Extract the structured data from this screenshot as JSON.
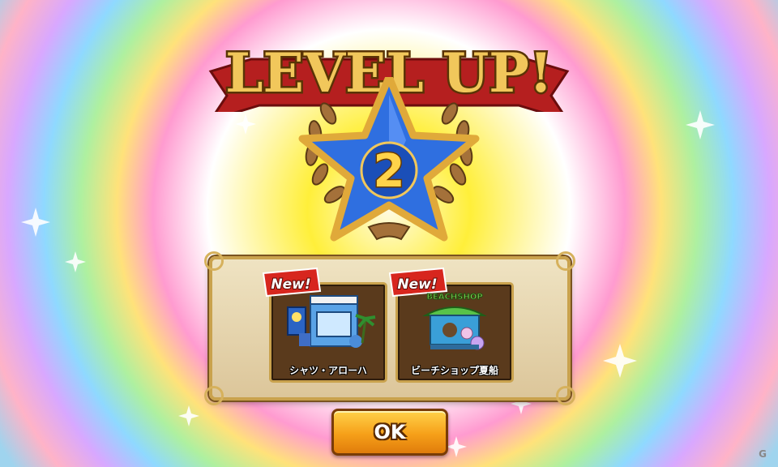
{
  "screen": {
    "title": "LEVEL UP!",
    "level": "2"
  },
  "rewards": {
    "badge_text": "New!",
    "items": [
      {
        "name": "シャツ・アローハ",
        "art": "shirt-shop-building"
      },
      {
        "name": "ビーチショップ夏船",
        "art": "beach-shop-building",
        "sign": "BEACHSHOP"
      }
    ]
  },
  "ok_button": {
    "label": "OK"
  },
  "watermark": "G",
  "colors": {
    "gold": "#f1c75b",
    "star_blue": "#2f6fe0",
    "ribbon_red": "#b51f1f",
    "button_orange": "#f6a019"
  },
  "icons": [
    "laurel-wreath-icon",
    "star-icon",
    "new-badge-icon"
  ]
}
